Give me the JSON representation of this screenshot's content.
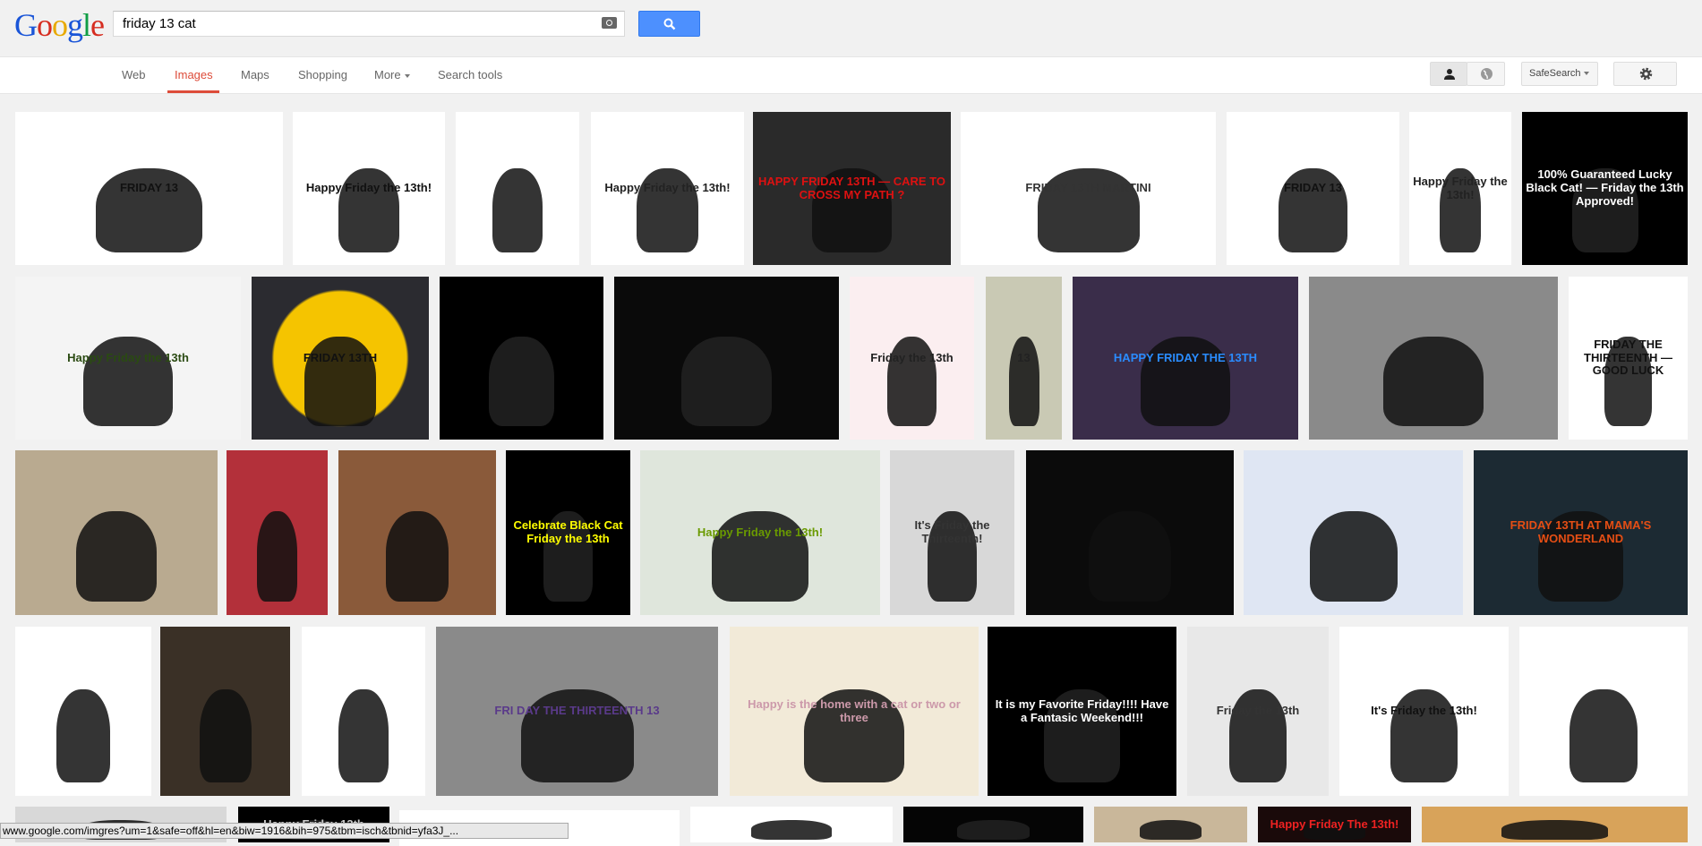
{
  "header": {
    "logo": "Google",
    "search_value": "friday 13 cat",
    "camera_icon": "camera-icon",
    "search_icon": "magnifier-icon"
  },
  "nav": {
    "tabs": [
      {
        "label": "Web"
      },
      {
        "label": "Images"
      },
      {
        "label": "Maps"
      },
      {
        "label": "Shopping"
      },
      {
        "label": "More"
      },
      {
        "label": "Search tools"
      }
    ],
    "active_tab": "Images",
    "safesearch_label": "SafeSearch"
  },
  "colors": {
    "accent": "#dd4b39",
    "button_blue": "#4d90fe"
  },
  "results": {
    "rows": [
      [
        {
          "bg": "#ffffff",
          "fg": "#111",
          "caption": "FRIDAY 13"
        },
        {
          "bg": "#ffffff",
          "fg": "#111",
          "caption": "Happy Friday the 13th!"
        },
        {
          "bg": "#ffffff",
          "fg": "#111",
          "caption": ""
        },
        {
          "bg": "#ffffff",
          "fg": "#222",
          "caption": "Happy Friday the 13th!"
        },
        {
          "bg": "#2a2a2a",
          "fg": "#d11",
          "caption": "HAPPY FRIDAY 13TH — CARE TO CROSS MY PATH ?"
        },
        {
          "bg": "#ffffff",
          "fg": "#333",
          "caption": "FRIDAY 13TH MARTINI"
        },
        {
          "bg": "#ffffff",
          "fg": "#111",
          "caption": "FRIDAY 13"
        },
        {
          "bg": "#ffffff",
          "fg": "#222",
          "caption": "Happy Friday the 13th!"
        },
        {
          "bg": "#000000",
          "fg": "#fff",
          "caption": "100% Guaranteed Lucky Black Cat! — Friday the 13th Approved!"
        }
      ],
      [
        {
          "bg": "#f4f4f4",
          "fg": "#2a4a12",
          "caption": "Happy Friday the 13th"
        },
        {
          "bg": "#2b2b30",
          "fg": "#111",
          "caption": "FRIDAY 13TH",
          "inner": "#f5c400"
        },
        {
          "bg": "#000000",
          "fg": "#6f6",
          "caption": ""
        },
        {
          "bg": "#0a0a0a",
          "fg": "#ddd",
          "caption": ""
        },
        {
          "bg": "#fbeef0",
          "fg": "#222",
          "caption": "Friday the 13th"
        },
        {
          "bg": "#c9c9b4",
          "fg": "#222",
          "caption": "13"
        },
        {
          "bg": "#3a2d4a",
          "fg": "#2a8cff",
          "caption": "HAPPY FRIDAY THE 13TH"
        },
        {
          "bg": "#8a8a8a",
          "fg": "#111",
          "caption": ""
        },
        {
          "bg": "#ffffff",
          "fg": "#111",
          "caption": "FRIDAY THE THIRTEENTH — GOOD LUCK"
        }
      ],
      [
        {
          "bg": "#b9aa90",
          "fg": "#111",
          "caption": ""
        },
        {
          "bg": "#b3303a",
          "fg": "#111",
          "caption": ""
        },
        {
          "bg": "#8a5a3a",
          "fg": "#fff",
          "caption": ""
        },
        {
          "bg": "#000000",
          "fg": "#ff0",
          "caption": "Celebrate Black Cat Friday the 13th"
        },
        {
          "bg": "#dfe6dc",
          "fg": "#6a9a00",
          "caption": "Happy Friday the 13th!"
        },
        {
          "bg": "#d8d8d8",
          "fg": "#333",
          "caption": "It's Friday the Thirteenth!"
        },
        {
          "bg": "#0b0b0b",
          "fg": "#aa8",
          "caption": ""
        },
        {
          "bg": "#dfe6f3",
          "fg": "#333",
          "caption": ""
        },
        {
          "bg": "#1c2a33",
          "fg": "#e54e14",
          "caption": "FRIDAY 13TH AT MAMA'S WONDERLAND"
        }
      ],
      [
        {
          "bg": "#ffffff",
          "fg": "#111",
          "caption": ""
        },
        {
          "bg": "#3a3026",
          "fg": "#ee0",
          "caption": ""
        },
        {
          "bg": "#ffffff",
          "fg": "#111",
          "caption": ""
        },
        {
          "bg": "#8a8a8a",
          "fg": "#5a3a8a",
          "caption": "FRI DAY THE THIRTEENTH 13"
        },
        {
          "bg": "#f2ead8",
          "fg": "#c9a",
          "caption": "Happy is the home with a cat or two or three"
        },
        {
          "bg": "#000000",
          "fg": "#fff",
          "caption": "It is my Favorite Friday!!!! Have a Fantasic Weekend!!!"
        },
        {
          "bg": "#e8e8e8",
          "fg": "#333",
          "caption": "Friday the 13th"
        },
        {
          "bg": "#ffffff",
          "fg": "#111",
          "caption": "It's Friday the 13th!"
        },
        {
          "bg": "#ffffff",
          "fg": "#111",
          "caption": ""
        }
      ],
      [
        {
          "bg": "#d8d8d8",
          "fg": "#111",
          "caption": ""
        },
        {
          "bg": "#000000",
          "fg": "#ccc",
          "caption": "Happy Friday 13th"
        },
        {
          "bg": "#ffffff",
          "fg": "#111",
          "caption": ""
        },
        {
          "bg": "#050505",
          "fg": "#111",
          "caption": ""
        },
        {
          "bg": "#c9b79a",
          "fg": "#111",
          "caption": ""
        },
        {
          "bg": "#1a0a0a",
          "fg": "#e22",
          "caption": "Happy Friday The 13th!"
        },
        {
          "bg": "#d8a35a",
          "fg": "#111",
          "caption": ""
        },
        {
          "bg": "#bdbdbd",
          "fg": "#111",
          "caption": ""
        }
      ]
    ]
  },
  "status_bar": {
    "url": "www.google.com/imgres?um=1&safe=off&hl=en&biw=1916&bih=975&tbm=isch&tbnid=yfa3J_..."
  }
}
